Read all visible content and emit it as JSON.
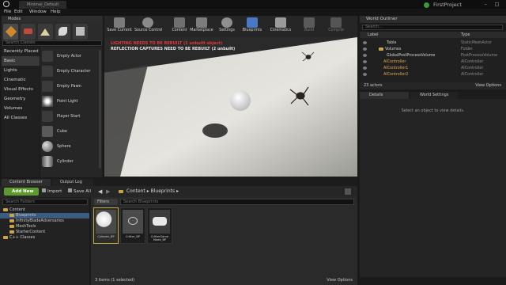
{
  "window": {
    "doc_tab": "Minimal_Default",
    "project": "FirstProject",
    "controls": "– □ ✕"
  },
  "menu": [
    "File",
    "Edit",
    "Window",
    "Help"
  ],
  "modes": {
    "title": "Modes",
    "search_placeholder": "Search Classes",
    "categories": [
      "Recently Placed",
      "Basic",
      "Lights",
      "Cinematic",
      "Visual Effects",
      "Geometry",
      "Volumes",
      "All Classes"
    ],
    "selected_category": "Basic",
    "items": [
      "Empty Actor",
      "Empty Character",
      "Empty Pawn",
      "Point Light",
      "Player Start",
      "Cube",
      "Sphere",
      "Cylinder"
    ]
  },
  "toolbar": {
    "buttons": [
      {
        "label": "Save Current",
        "icon": "save-icon"
      },
      {
        "label": "Source Control",
        "icon": "source-control-icon"
      },
      {
        "label": "Content",
        "icon": "content-icon"
      },
      {
        "label": "Marketplace",
        "icon": "marketplace-icon"
      },
      {
        "label": "Settings",
        "icon": "gear-icon"
      },
      {
        "label": "Blueprints",
        "icon": "blueprint-icon"
      },
      {
        "label": "Cinematics",
        "icon": "cinematics-icon"
      },
      {
        "label": "Build",
        "icon": "build-icon"
      },
      {
        "label": "Compile",
        "icon": "compile-icon"
      }
    ]
  },
  "viewport": {
    "warning_lighting": "LIGHTING NEEDS TO BE REBUILT (1 unbuilt object)",
    "warning_reflection": "REFLECTION CAPTURES NEED TO BE REBUILT (2 unbuilt)"
  },
  "outliner": {
    "title": "World Outliner",
    "search_placeholder": "Search...",
    "col_label": "Label",
    "col_type": "Type",
    "rows": [
      {
        "name": "Table",
        "type": "StaticMeshActor",
        "indent": 1
      },
      {
        "name": "Volumes",
        "type": "Folder",
        "indent": 0
      },
      {
        "name": "GlobalPostProcessVolume",
        "type": "PostProcessVolume",
        "indent": 1
      },
      {
        "name": "AIController",
        "type": "AIController",
        "indent": 0
      },
      {
        "name": "AIController1",
        "type": "AIController",
        "indent": 0
      },
      {
        "name": "AIController2",
        "type": "AIController",
        "indent": 0
      }
    ],
    "actor_count": "23 actors",
    "view_options": "View Options"
  },
  "details": {
    "tab_details": "Details",
    "tab_world_settings": "World Settings",
    "empty_message": "Select an object to view details."
  },
  "content_browser": {
    "tab_content": "Content Browser",
    "tab_output": "Output Log",
    "add_new": "Add New",
    "import": "Import",
    "save_all": "Save All",
    "breadcrumb_root": "Content",
    "breadcrumb_folder": "Blueprints",
    "folder_search_placeholder": "Search Folders",
    "asset_search_placeholder": "Search Blueprints",
    "filters": "Filters",
    "tree": [
      {
        "label": "Content",
        "indent": 0
      },
      {
        "label": "Blueprints",
        "indent": 1
      },
      {
        "label": "InfinityBladeAdversaries",
        "indent": 1
      },
      {
        "label": "MeshTools",
        "indent": 1
      },
      {
        "label": "StarterContent",
        "indent": 1
      },
      {
        "label": "C++ Classes",
        "indent": 0
      }
    ],
    "selected_tree": "Blueprints",
    "assets": [
      {
        "label": "Cylinder_BP",
        "selected": true
      },
      {
        "label": "Critter_BP",
        "selected": false
      },
      {
        "label": "CritterGame Mode_BP",
        "selected": false
      }
    ],
    "status": "3 items (1 selected)",
    "view_options": "View Options"
  },
  "colors": {
    "accent_green": "#5e9b2e",
    "warning_red": "#e03a3a",
    "selection_blue": "#3d5a80",
    "actor_orange": "#e3a94a"
  }
}
